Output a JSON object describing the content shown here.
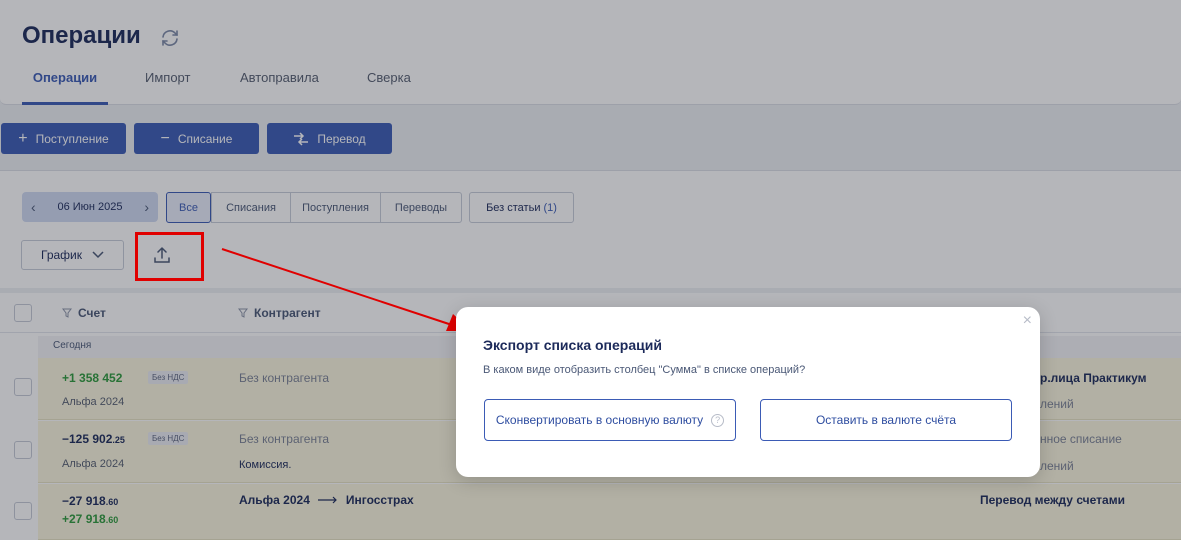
{
  "header": {
    "title": "Операции",
    "tabs": [
      {
        "label": "Операции",
        "active": true
      },
      {
        "label": "Импорт"
      },
      {
        "label": "Автоправила"
      },
      {
        "label": "Сверка"
      }
    ]
  },
  "actions": {
    "income_label": "Поступление",
    "expense_label": "Списание",
    "transfer_label": "Перевод"
  },
  "filters": {
    "date": "06 Июн 2025",
    "segments": [
      "Все",
      "Списания",
      "Поступления",
      "Переводы"
    ],
    "active_segment": "Все",
    "no_category_label": "Без статьи",
    "no_category_count": "(1)",
    "chart_label": "График"
  },
  "table": {
    "columns": {
      "account": "Счет",
      "counterparty": "Контрагент"
    },
    "group_label": "Сегодня",
    "rows": [
      {
        "amount_main": "+1 358 452",
        "amount_cents": "",
        "amount_kind": "plus",
        "account": "Альфа 2024",
        "vat": "Без НДС",
        "counterparty": "Без контрагента",
        "counterparty_sub": "",
        "right_top": "р.лица Практикум",
        "right_sub": "лений"
      },
      {
        "amount_main": "−125 902",
        "amount_cents": ".25",
        "amount_kind": "minus",
        "account": "Альфа 2024",
        "vat": "Без НДС",
        "counterparty": "Без контрагента",
        "counterparty_sub": "Комиссия.",
        "right_top": "нное списание",
        "right_sub": "лений"
      },
      {
        "amount_main": "−27 918",
        "amount_cents": ".60",
        "amount_kind": "minus",
        "amount2_main": "+27 918",
        "amount2_cents": ".60",
        "transfer_from": "Альфа 2024",
        "transfer_to": "Ингосстрах",
        "right_top": "Перевод между счетами"
      }
    ]
  },
  "modal": {
    "title": "Экспорт списка операций",
    "question": "В каком виде отобразить столбец \"Сумма\" в списке операций?",
    "convert_label": "Сконвертировать в основную валюту",
    "keep_label": "Оставить в валюте счёта",
    "close_icon": "close-icon",
    "help_icon": "help-icon"
  },
  "colors": {
    "accent": "#3b5bb5",
    "annotation": "#e00000",
    "income": "#2d9a3b"
  }
}
